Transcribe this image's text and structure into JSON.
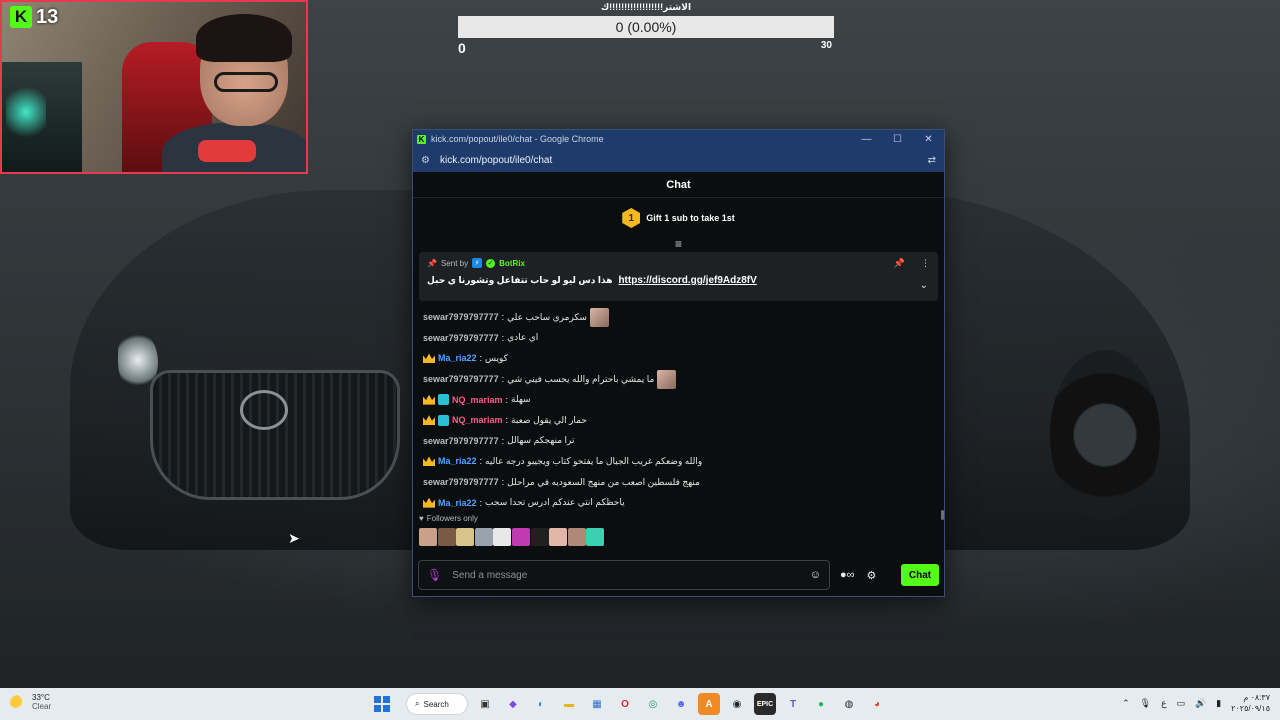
{
  "webcam": {
    "platform_logo": "K",
    "viewer_count": "13"
  },
  "goal": {
    "title": "الاشتر!!!!!!!!!!!!!!!!!!ك",
    "value": "0 (0.00%)",
    "min": "0",
    "max": "30",
    "progress": 0
  },
  "window": {
    "title": "kick.com/popout/ile0/chat - Google Chrome",
    "url": "kick.com/popout/ile0/chat",
    "minimize": "—",
    "maximize": "☐",
    "close": "✕"
  },
  "chat": {
    "header": "Chat",
    "gift": {
      "rank": "1",
      "text": "Gift 1 sub to take 1st"
    },
    "pinned": {
      "sent_by": "Sent by",
      "bot_name": "BotRix",
      "message": "هذا دس ليو لو حاب تتفاعل وتشورنا ي حبل",
      "link": "https://discord.gg/jef9Adz8fV"
    },
    "messages": [
      {
        "user": "sewar7979797777",
        "color": "grey",
        "badges": [],
        "text": "سكرمري ساحب علي",
        "emote": true
      },
      {
        "user": "sewar7979797777",
        "color": "grey",
        "badges": [],
        "text": "اي عادي",
        "emote": false
      },
      {
        "user": "Ma_ria22",
        "color": "blue",
        "badges": [
          "crown"
        ],
        "text": "كويس",
        "emote": false
      },
      {
        "user": "sewar7979797777",
        "color": "grey",
        "badges": [],
        "text": "ما يمشي باحترام والله يحسب فيني شي",
        "emote": true
      },
      {
        "user": "NQ_mariam",
        "color": "pink",
        "badges": [
          "crown",
          "sub"
        ],
        "text": "سهلة",
        "emote": false
      },
      {
        "user": "NQ_mariam",
        "color": "pink",
        "badges": [
          "crown",
          "sub"
        ],
        "text": "حمار الي يقول صعبة",
        "emote": false
      },
      {
        "user": "sewar7979797777",
        "color": "grey",
        "badges": [],
        "text": "ترا منهجكم سهالل",
        "emote": false
      },
      {
        "user": "Ma_ria22",
        "color": "blue",
        "badges": [
          "crown"
        ],
        "text": "والله وضعكم غريب الجيال ما يفتحو كتاب ويجيبو درجه عاليه",
        "emote": false
      },
      {
        "user": "sewar7979797777",
        "color": "grey",
        "badges": [],
        "text": "منهج فلسطين اصعب من منهج السعوديه في مراحلل",
        "emote": false
      },
      {
        "user": "Ma_ria22",
        "color": "blue",
        "badges": [
          "crown"
        ],
        "text": "ياحظكم انتي عندكم ادرس تحدا سحب",
        "emote": false
      }
    ],
    "followers_only": "Followers only",
    "input_placeholder": "Send a message",
    "send_label": "Chat"
  },
  "taskbar": {
    "weather_temp": "33°C",
    "weather_desc": "Clear",
    "search_label": "Search",
    "time": "٠٨:٣٧ م",
    "date": "٢٠٢٥/٠٩/١٥",
    "lang": "ع"
  },
  "colors": {
    "kick_green": "#53fc18",
    "window_blue": "#1f3b6b",
    "webcam_border": "#e63a4e"
  }
}
